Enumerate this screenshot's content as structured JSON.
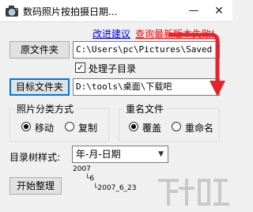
{
  "window": {
    "title": "数码照片按拍摄日期...",
    "minimize_glyph": "—",
    "close_glyph": "✕"
  },
  "links": {
    "feedback": "改进建议",
    "update_failed": "查询最新版本失败!"
  },
  "source": {
    "button_label": "原文件夹",
    "path": "C:\\Users\\pc\\Pictures\\Saved Pic"
  },
  "include_subdirs": {
    "label": "处理子目录",
    "checked": true,
    "glyph": "✓"
  },
  "target": {
    "button_label": "目标文件夹",
    "path": "D:\\tools\\桌面\\下载吧"
  },
  "sort_mode": {
    "title": "照片分类方式",
    "options": [
      "移动",
      "复制"
    ],
    "selected": "移动"
  },
  "duplicate_mode": {
    "title": "重名文件",
    "options": [
      "覆盖",
      "重命名"
    ],
    "selected": "覆盖"
  },
  "tree_style": {
    "label": "目录树样式:",
    "selected": "年-月-日期",
    "arrow_glyph": "▼",
    "preview": [
      "2007",
      "└6",
      "└2007_6_23"
    ]
  },
  "actions": {
    "start_label": "开始整理"
  },
  "colors": {
    "link_blue": "#0000ee",
    "link_red": "#ff0000",
    "annotation_arrow": "#e4232a",
    "focus_border": "#0078d7"
  },
  "icons": {
    "app": "camera-icon",
    "annotation": "red-arrow-icon"
  }
}
